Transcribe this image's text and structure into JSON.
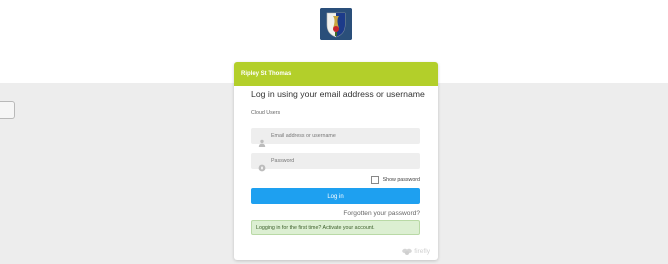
{
  "logo": {
    "icon": "school-crest-icon"
  },
  "card": {
    "header": "Ripley St Thomas",
    "title": "Log in using your email address or username",
    "section_label": "Cloud Users",
    "email": {
      "icon": "user-icon",
      "value": "",
      "placeholder": "Email address or username"
    },
    "password": {
      "icon": "lock-icon",
      "value": "",
      "placeholder": "Password"
    },
    "show_password_label": "Show password",
    "login_button_label": "Log in",
    "forgot_link": "Forgotten your password?",
    "activate_message": "Logging in for the first time? Activate your account.",
    "brand": "firefly"
  },
  "colors": {
    "header": "#b3cf2a",
    "button": "#1ea0f0",
    "notice_bg": "#dcefd2",
    "page_bg": "#ededed"
  }
}
